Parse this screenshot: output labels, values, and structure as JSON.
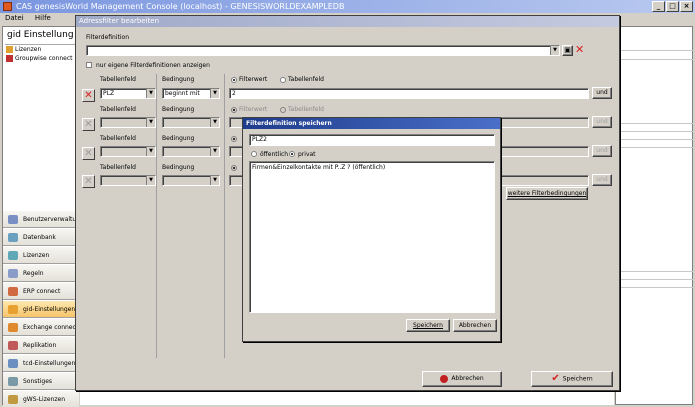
{
  "window": {
    "title": "CAS genesisWorld Management Console (localhost) - GENESISWORLDEXAMPLEDB",
    "minimize": "_",
    "maximize": "□",
    "close": "×"
  },
  "menu": {
    "items": [
      "Datei",
      "Hilfe"
    ]
  },
  "left_panel": {
    "title": "gid Einstellung",
    "tree": [
      "Lizenzen",
      "Groupwise connect"
    ],
    "nav": [
      {
        "label": "Benutzerverwaltung",
        "color": "#7a8fc4"
      },
      {
        "label": "Datenbank",
        "color": "#6aa0c0"
      },
      {
        "label": "Lizenzen",
        "color": "#5fa8b8"
      },
      {
        "label": "Regeln",
        "color": "#8a9cc8"
      },
      {
        "label": "ERP connect",
        "color": "#d06a40"
      },
      {
        "label": "gid-Einstellungen",
        "color": "#e8a030"
      },
      {
        "label": "Exchange connect",
        "color": "#e08a30"
      },
      {
        "label": "Replikation",
        "color": "#c05a5a"
      },
      {
        "label": "tcd-Einstellungen",
        "color": "#6a8fc0"
      },
      {
        "label": "Sonstiges",
        "color": "#7a9aa8"
      },
      {
        "label": "gWS-Lizenzen",
        "color": "#c09a40"
      }
    ]
  },
  "dialog": {
    "title": "Adressfilter bearbeiten",
    "filterdefinition_label": "Filterdefinition",
    "filterdefinition_value": "",
    "own_only_label": "nur eigene Filterdefinitionen anzeigen",
    "rows": [
      {
        "tabellenfeld_label": "Tabellenfeld",
        "bedingung_label": "Bedingung",
        "filterwert_label": "Filterwert",
        "tabellenfeld_radio_label": "Tabellenfeld",
        "tabellenfeld_value": "PLZ",
        "bedingung_value": "beginnt mit",
        "filter_value": "2",
        "button": "und",
        "enabled": true
      },
      {
        "tabellenfeld_label": "Tabellenfeld",
        "bedingung_label": "Bedingung",
        "filterwert_label": "Filterwert",
        "tabellenfeld_radio_label": "Tabellenfeld",
        "tabellenfeld_value": "",
        "bedingung_value": "",
        "filter_value": "",
        "button": "und",
        "enabled": false
      },
      {
        "tabellenfeld_label": "Tabellenfeld",
        "bedingung_label": "Bedingung",
        "filterwert_label": "",
        "tabellenfeld_radio_label": "",
        "tabellenfeld_value": "",
        "bedingung_value": "",
        "filter_value": "",
        "button": "und",
        "enabled": false
      },
      {
        "tabellenfeld_label": "Tabellenfeld",
        "bedingung_label": "Bedingung",
        "filterwert_label": "",
        "tabellenfeld_radio_label": "",
        "tabellenfeld_value": "",
        "bedingung_value": "",
        "filter_value": "",
        "button": "und",
        "enabled": false
      }
    ],
    "more_button": "weitere Filterbedingungen",
    "cancel_button": "Abbrechen",
    "save_button": "Speichern"
  },
  "sub_dialog": {
    "title": "Filterdefinition speichern",
    "name_value": "PLZ2",
    "public_label": "öffentlich",
    "private_label": "privat",
    "list_items": [
      "Firmen&Einzelkontakte mit P..Z ? (öffentlich)"
    ],
    "save_button": "Speichern",
    "cancel_button": "Abbrechen"
  },
  "colors": {
    "accent_red": "#d62020",
    "check_red": "#d62020"
  }
}
